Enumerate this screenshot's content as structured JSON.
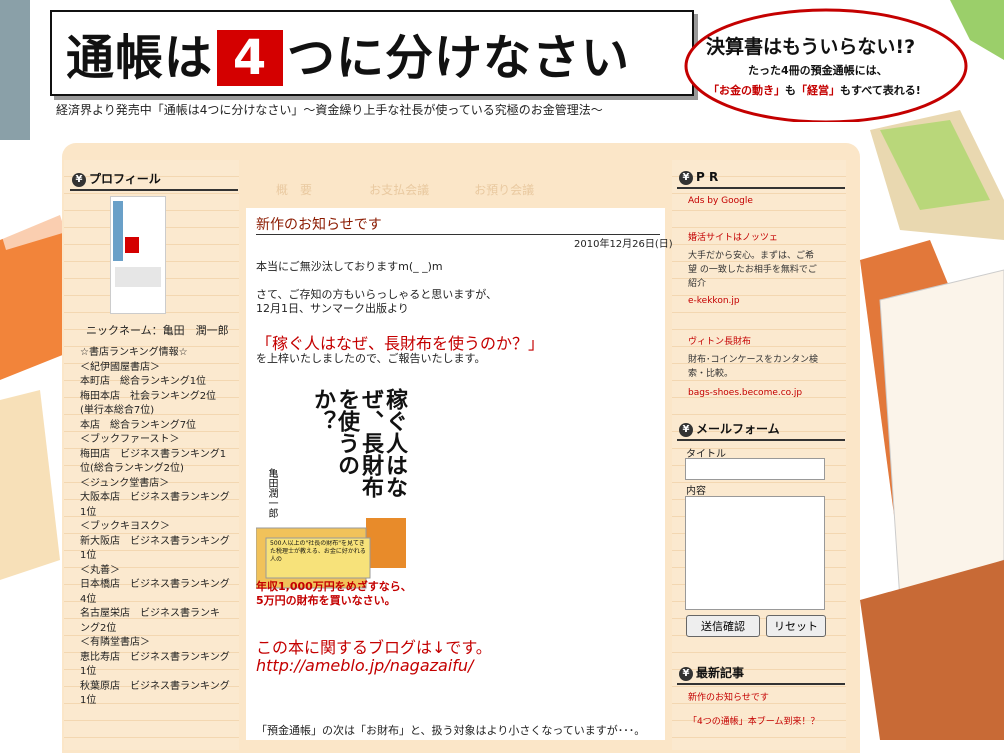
{
  "header": {
    "title_pre": "通帳は",
    "title_num": "4",
    "title_post": "つに分けなさい",
    "subtitle": "経済界より発売中「通帳は4つに分けなさい」～資金繰り上手な社長が使っている究極のお金管理法～"
  },
  "promo": {
    "line1": "決算書はもういらない!?",
    "line2": "たった4冊の預金通帳には、",
    "line3_a": "「お金の動き」",
    "line3_b": "も",
    "line3_c": "「経営」",
    "line3_d": "もすべて表れる!"
  },
  "nav": [
    "概　要",
    "お支払会議",
    "お預り会議"
  ],
  "sidebar_left": {
    "profile_heading": "プロフィール",
    "nickname": "ニックネーム：亀田　潤一郎",
    "ranking": [
      "☆書店ランキング情報☆",
      "＜紀伊國屋書店＞",
      "本町店　総合ランキング1位",
      "梅田本店　社会ランキング2位",
      "(単行本総合7位)",
      "本店　総合ランキング7位",
      "＜ブックファースト＞",
      "梅田店　ビジネス書ランキング1",
      "位(総合ランキング2位)",
      "＜ジュンク堂書店＞",
      "大阪本店　ビジネス書ランキング",
      "1位",
      "＜ブックキヨスク＞",
      "新大阪店　ビジネス書ランキング",
      "1位",
      "＜丸善＞",
      "日本橋店　ビジネス書ランキング",
      "4位",
      "名古屋栄店　ビジネス書ランキ",
      "ング2位",
      "＜有隣堂書店＞",
      "恵比寿店　ビジネス書ランキング",
      "1位",
      "秋葉原店　ビジネス書ランキング",
      "1位"
    ]
  },
  "post": {
    "title": "新作のお知らせです",
    "date": "2010年12月26日(日)",
    "p1": "本当にご無沙汰しておりますm(_ _)m",
    "p2": "さて、ご存知の方もいらっしゃると思いますが、",
    "p3": "12月1日、サンマーク出版より",
    "book_title_red": "「稼ぐ人はなぜ、長財布を使うのか？」",
    "p4": "を上梓いたしましたので、ご報告いたします。",
    "blog_red": "この本に関するブログは↓です。",
    "blog_url": "http://ameblo.jp/nagazaifu/",
    "p5": "「預金通帳」の次は「お財布」と、扱う対象はより小さくなっていますが･･･。"
  },
  "book_cover": {
    "title": "稼ぐ人はなぜ、長財布を使うのか？",
    "author": "亀田潤一郎",
    "band1": "500人以上の\"社長の財布\"を見てきた税理士が教える、お金に好かれる人の",
    "band2": "年収1,000万円をめざすなら、",
    "band3": "5万円の財布を買いなさい。"
  },
  "sidebar_right": {
    "pr_heading": "P R",
    "ads_label": "Ads by Google",
    "ads": [
      {
        "title": "婚活サイトはノッツェ",
        "desc1": "大手だから安心。まずは、ご希",
        "desc2": "望 の一致したお相手を無料でご",
        "desc3": "紹介",
        "url": "e-kekkon.jp"
      },
      {
        "title": "ヴィトン長財布",
        "desc1": "財布･コインケースをカンタン検",
        "desc2": "索・比較。",
        "url": "bags-shoes.become.co.jp"
      }
    ],
    "mail_heading": "メールフォーム",
    "mail_title_label": "タイトル",
    "mail_body_label": "内容",
    "send_button": "送信確認",
    "reset_button": "リセット",
    "recent_heading": "最新記事",
    "recent": [
      "新作のお知らせです",
      "「4つの通帳」本ブーム到来！？"
    ]
  },
  "colors": {
    "accent_red": "#c40000",
    "title_brown": "#8b1a00",
    "sidebar_bg": "#fbe9cf"
  }
}
